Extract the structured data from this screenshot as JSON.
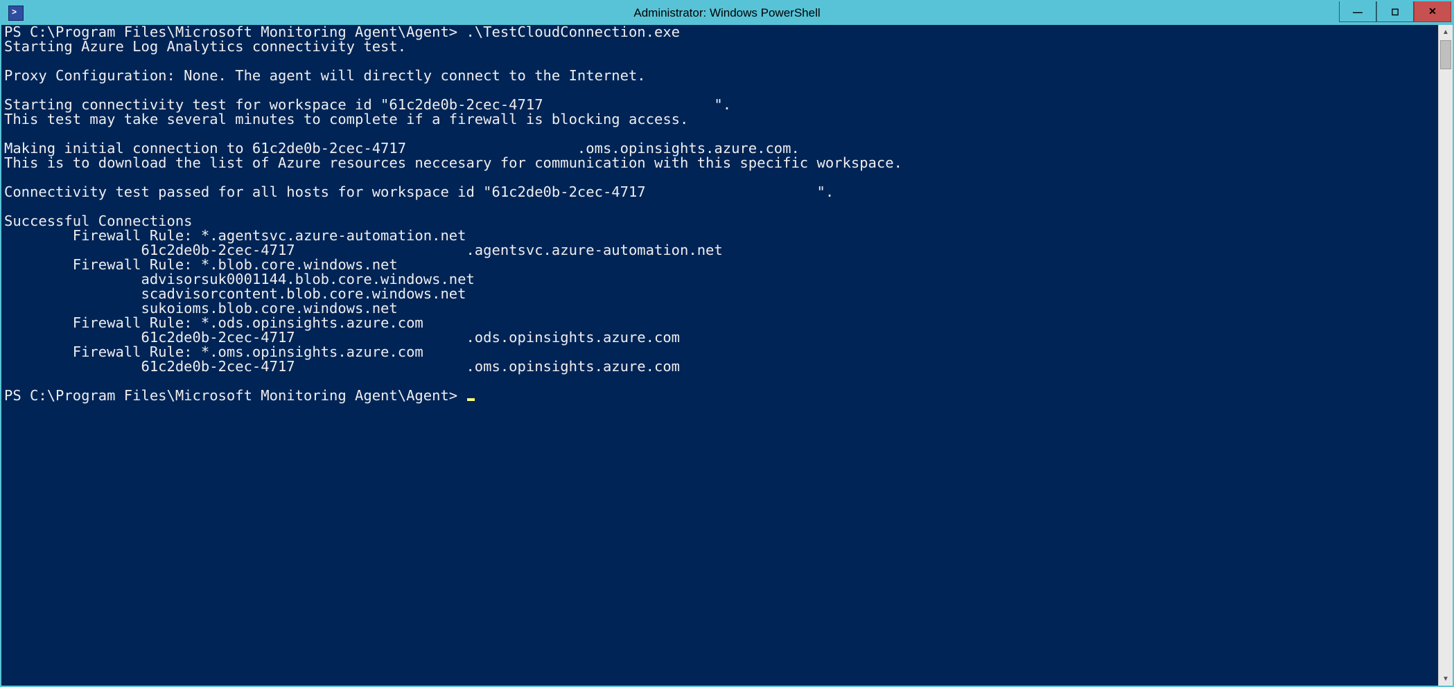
{
  "titlebar": {
    "title": "Administrator: Windows PowerShell"
  },
  "controls": {
    "minimize_tooltip": "Minimize",
    "maximize_tooltip": "Maximize",
    "close_tooltip": "Close"
  },
  "console": {
    "lines": [
      "PS C:\\Program Files\\Microsoft Monitoring Agent\\Agent> .\\TestCloudConnection.exe",
      "Starting Azure Log Analytics connectivity test.",
      "",
      "Proxy Configuration: None. The agent will directly connect to the Internet.",
      "",
      "Starting connectivity test for workspace id \"61c2de0b-2cec-4717                    \".",
      "This test may take several minutes to complete if a firewall is blocking access.",
      "",
      "Making initial connection to 61c2de0b-2cec-4717                    .oms.opinsights.azure.com.",
      "This is to download the list of Azure resources neccesary for communication with this specific workspace.",
      "",
      "Connectivity test passed for all hosts for workspace id \"61c2de0b-2cec-4717                    \".",
      "",
      "Successful Connections",
      "        Firewall Rule: *.agentsvc.azure-automation.net",
      "                61c2de0b-2cec-4717                    .agentsvc.azure-automation.net",
      "        Firewall Rule: *.blob.core.windows.net",
      "                advisorsuk0001144.blob.core.windows.net",
      "                scadvisorcontent.blob.core.windows.net",
      "                sukoioms.blob.core.windows.net",
      "        Firewall Rule: *.ods.opinsights.azure.com",
      "                61c2de0b-2cec-4717                    .ods.opinsights.azure.com",
      "        Firewall Rule: *.oms.opinsights.azure.com",
      "                61c2de0b-2cec-4717                    .oms.opinsights.azure.com",
      "",
      "PS C:\\Program Files\\Microsoft Monitoring Agent\\Agent> "
    ]
  }
}
